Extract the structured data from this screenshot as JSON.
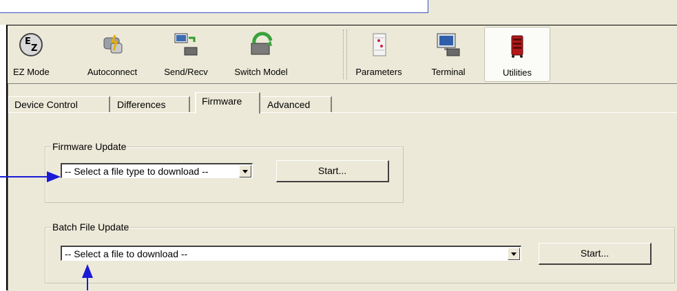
{
  "toolbar": {
    "items": [
      {
        "label": "EZ Mode",
        "icon": "ez-mode-icon"
      },
      {
        "label": "Autoconnect",
        "icon": "autoconnect-icon"
      },
      {
        "label": "Send/Recv",
        "icon": "send-recv-icon"
      },
      {
        "label": "Switch Model",
        "icon": "switch-model-icon"
      },
      {
        "label": "Parameters",
        "icon": "parameters-icon"
      },
      {
        "label": "Terminal",
        "icon": "terminal-icon"
      },
      {
        "label": "Utilities",
        "icon": "utilities-icon",
        "selected": true
      }
    ]
  },
  "tabs": [
    {
      "label": "Device Control"
    },
    {
      "label": "Differences"
    },
    {
      "label": "Firmware",
      "active": true
    },
    {
      "label": "Advanced"
    }
  ],
  "firmware_update": {
    "legend": "Firmware Update",
    "select_value": "-- Select a file type to download --",
    "start_label": "Start..."
  },
  "batch_update": {
    "legend": "Batch File Update",
    "select_value": "-- Select a file to download --",
    "start_label": "Start..."
  },
  "colors": {
    "accent": "#1a1ad6",
    "window_bg": "#ece9d8"
  }
}
